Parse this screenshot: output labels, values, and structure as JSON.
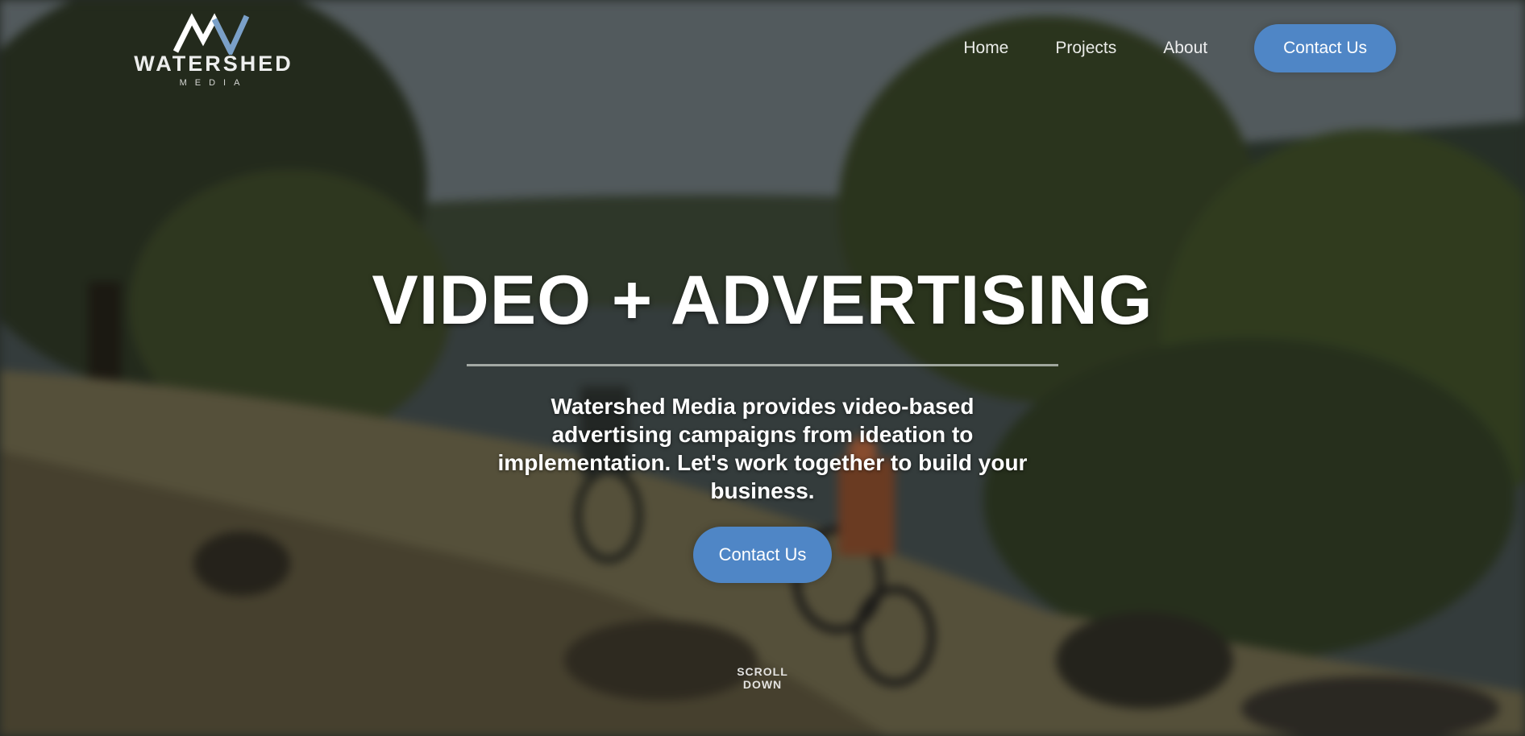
{
  "logo": {
    "name": "WATERSHED",
    "sub": "MEDIA"
  },
  "nav": {
    "items": [
      {
        "label": "Home"
      },
      {
        "label": "Projects"
      },
      {
        "label": "About"
      }
    ],
    "cta": "Contact Us"
  },
  "hero": {
    "headline": "VIDEO + ADVERTISING",
    "tagline": "Watershed Media provides video-based advertising campaigns from ideation to implementation. Let's work together to build your business.",
    "cta": "Contact Us",
    "scroll_hint": "SCROLL DOWN"
  },
  "colors": {
    "accent": "#4f86c6",
    "text": "#ffffff"
  }
}
